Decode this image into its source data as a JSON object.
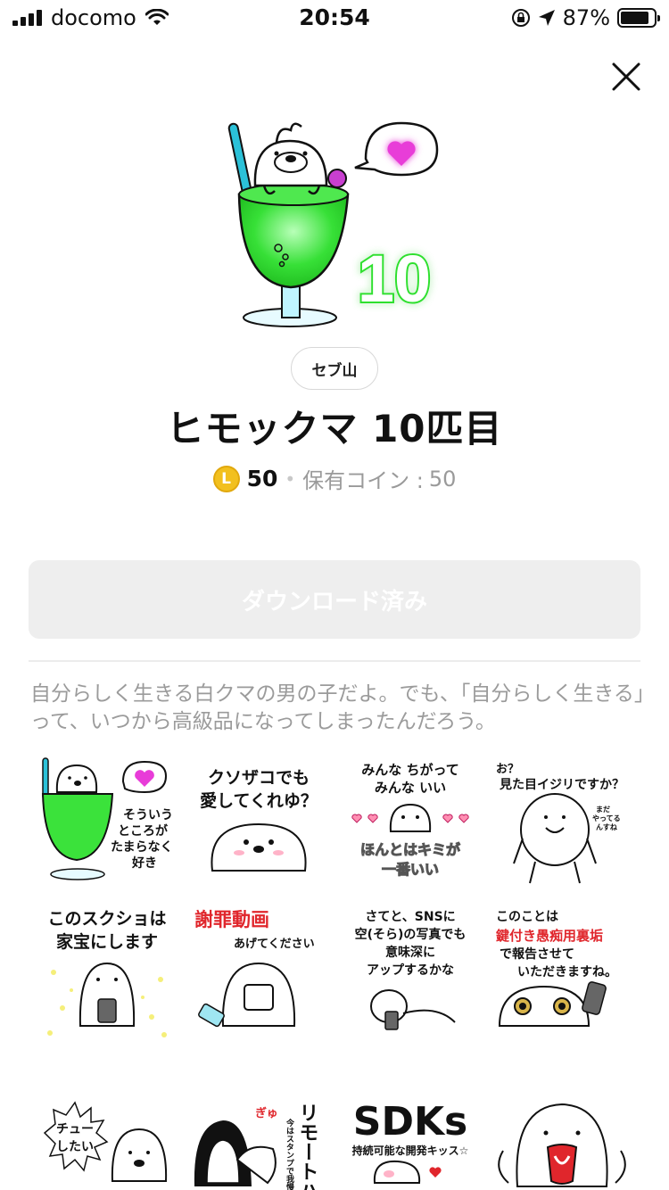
{
  "status_bar": {
    "carrier": "docomo",
    "time": "20:54",
    "battery": "87%",
    "battery_level": 0.87
  },
  "icons": {
    "close": "close-icon",
    "wifi": "wifi-icon",
    "location": "location-arrow-icon",
    "orientation_lock": "orientation-lock-icon"
  },
  "main_sticker": {
    "number_text": "10"
  },
  "sticker_pack": {
    "creator": "セブ山",
    "title": "ヒモックマ 10匹目",
    "coin_symbol": "L",
    "price": "50",
    "separator": "•",
    "owned_label": "保有コイン :",
    "owned_value": "50",
    "download_label": "ダウンロード済み",
    "description": "自分らしく生きる白クマの男の子だよ。でも、「自分らしく生きる」って、いつから高級品になってしまったんだろう。"
  },
  "stickers": [
    {
      "lines": [
        "そういう",
        "ところが",
        "たまらなく",
        "好き"
      ]
    },
    {
      "lines": [
        "クソザコでも",
        "愛してくれゆ？"
      ]
    },
    {
      "lines": [
        "みんな ちがって",
        "みんな いい",
        "ほんとはキミが",
        "一番いい"
      ]
    },
    {
      "lines": [
        "お？",
        "見た目イジリですか？",
        "まだ",
        "やってる",
        "んすね"
      ]
    },
    {
      "lines": [
        "このスクショは",
        "家宝にします"
      ]
    },
    {
      "lines": [
        "謝罪動画",
        "あげてください"
      ]
    },
    {
      "lines": [
        "さてと、SNSに",
        "空(そら)の写真でも",
        "意味深に",
        "アップするかな"
      ]
    },
    {
      "lines": [
        "このことは",
        "鍵付き愚痴用裏垢",
        "で報告させて",
        "いただきますね。"
      ]
    },
    {
      "lines": [
        "チュー",
        "したい"
      ]
    },
    {
      "lines": [
        "ぎゅ",
        "リモートハ",
        "今はスタンプで我慢"
      ]
    },
    {
      "lines": [
        "SDKs",
        "持続可能な開発キッス☆"
      ]
    },
    {
      "lines": []
    }
  ],
  "colors": {
    "coin": "#f2c01e",
    "button_bg": "#eeeeee",
    "description": "#9b9b9b",
    "sticker_green": "#3be23b",
    "heart": "#e83cd8",
    "red_text": "#e0262c"
  }
}
